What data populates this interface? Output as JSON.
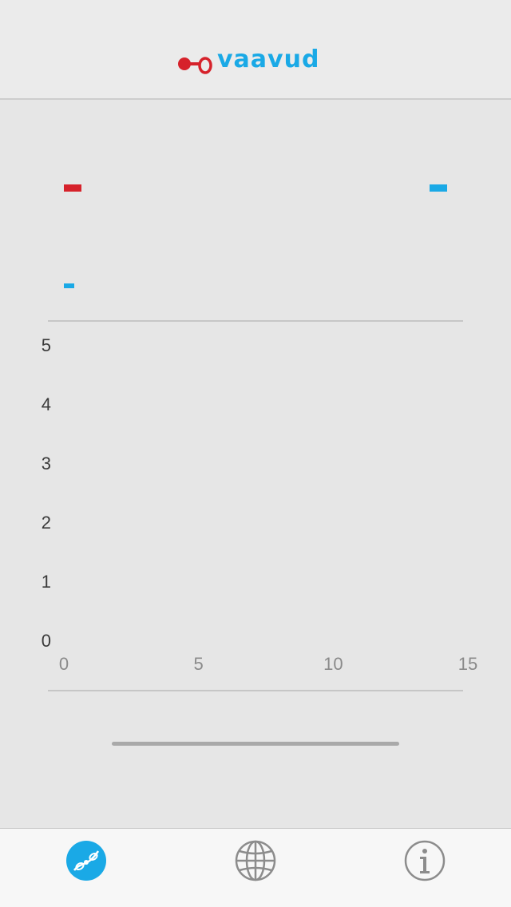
{
  "app": {
    "brand": "vaavud"
  },
  "colors": {
    "brand_red": "#d6222b",
    "brand_blue": "#1aa9e6",
    "background": "#e6e6e6",
    "tab_inactive": "#8c8c8c"
  },
  "readouts": {
    "current_speed": "",
    "max_speed": "",
    "average_speed": ""
  },
  "chart_data": {
    "type": "line",
    "title": "",
    "xlabel": "",
    "ylabel": "",
    "x_ticks": [
      "0",
      "5",
      "10",
      "15"
    ],
    "y_ticks": [
      "0",
      "1",
      "2",
      "3",
      "4",
      "5"
    ],
    "xlim": [
      0,
      15
    ],
    "ylim": [
      0,
      5
    ],
    "grid": false,
    "series": []
  },
  "measurement": {
    "progress": 0
  },
  "tabbar": {
    "items": [
      {
        "name": "measure",
        "icon": "wind-measure-icon",
        "active": true
      },
      {
        "name": "map",
        "icon": "globe-icon",
        "active": false
      },
      {
        "name": "info",
        "icon": "info-icon",
        "active": false
      }
    ]
  }
}
